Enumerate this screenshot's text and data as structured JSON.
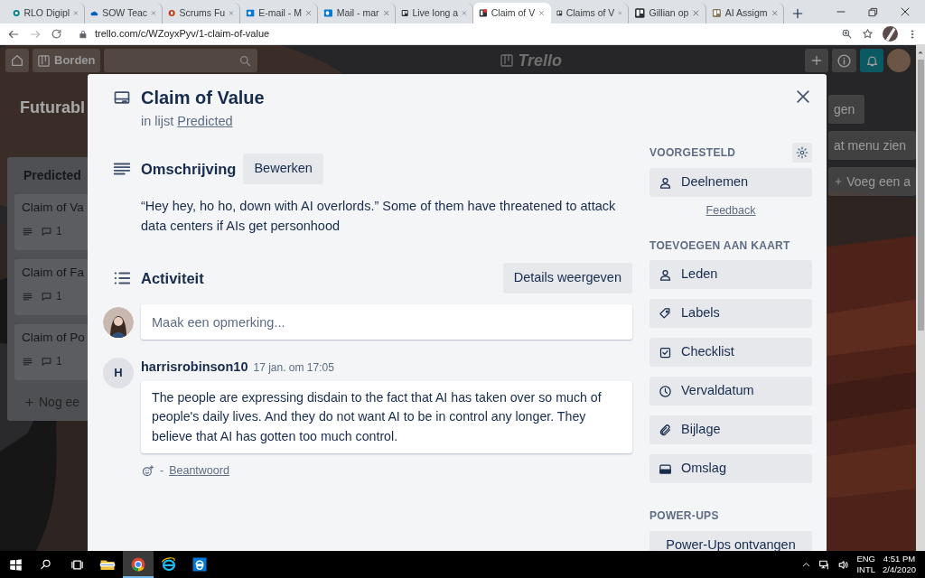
{
  "browser": {
    "tabs": [
      {
        "title": "RLO Digipl",
        "kind": "sharepoint",
        "selected": false
      },
      {
        "title": "SOW Teac",
        "kind": "onedrive",
        "selected": false
      },
      {
        "title": "Scrums Fu",
        "kind": "powerpoint",
        "selected": false
      },
      {
        "title": "E-mail - M",
        "kind": "outlook",
        "selected": false
      },
      {
        "title": "Mail - mar",
        "kind": "outlook",
        "selected": false
      },
      {
        "title": "Live long a",
        "kind": "trello",
        "selected": false
      },
      {
        "title": "Claim of V",
        "kind": "trello-alert",
        "selected": true
      },
      {
        "title": "Claims of V",
        "kind": "trello",
        "selected": false
      },
      {
        "title": "Gillian op",
        "kind": "trello",
        "selected": false
      },
      {
        "title": "AI Assigm",
        "kind": "trello-light",
        "selected": false
      }
    ],
    "url": "trello.com/c/WZoyxPyv/1-claim-of-value"
  },
  "board_header": {
    "boards_button": "Borden",
    "logo": "Trello"
  },
  "board": {
    "title": "Futurabl",
    "lists": [
      {
        "name": "Predicted",
        "cards": [
          {
            "title": "Claim of Va",
            "comments": "1"
          },
          {
            "title": "Claim of Fa",
            "comments": "1"
          },
          {
            "title": "Claim of Po",
            "comments": "1"
          }
        ],
        "add_card": "Nog ee"
      }
    ],
    "right_buttons": [
      "gen",
      "at menu zien"
    ],
    "add_list": "Voeg een a"
  },
  "card_detail": {
    "title": "Claim of Value",
    "list_prefix": "in lijst",
    "list_name": "Predicted",
    "description_heading": "Omschrijving",
    "edit_button": "Bewerken",
    "description": "“Hey hey, ho ho, down with AI overlords.” Some of them have threatened to attack data centers if AIs get personhood",
    "activity_heading": "Activiteit",
    "details_button": "Details weergeven",
    "comment_placeholder": "Maak een opmerking...",
    "comments": [
      {
        "avatar": "H",
        "author": "harrisrobinson10",
        "time": "17 jan. om 17:05",
        "text": "The people are expressing disdain to the fact that AI has taken over so much of people's daily lives. And they do not want AI to be in control any longer. They believe that AI has gotten too much control.",
        "separator": "-",
        "reply": "Beantwoord"
      }
    ]
  },
  "sidebar": {
    "suggested_heading": "VOORGESTELD",
    "join_button": "Deelnemen",
    "feedback": "Feedback",
    "add_heading": "TOEVOEGEN AAN KAART",
    "actions": [
      {
        "label": "Leden",
        "kind": "members"
      },
      {
        "label": "Labels",
        "kind": "labels"
      },
      {
        "label": "Checklist",
        "kind": "checklist"
      },
      {
        "label": "Vervaldatum",
        "kind": "due"
      },
      {
        "label": "Bijlage",
        "kind": "attachment"
      },
      {
        "label": "Omslag",
        "kind": "cover"
      }
    ],
    "powerups_heading": "POWER-UPS",
    "powerups_button": "Power-Ups ontvangen"
  },
  "taskbar": {
    "apps": [
      {
        "kind": "explorer",
        "selected": false
      },
      {
        "kind": "chrome",
        "selected": true
      },
      {
        "kind": "ie",
        "selected": false
      },
      {
        "kind": "edge",
        "selected": false
      }
    ],
    "language": "ENG",
    "layout": "INTL",
    "time": "4:51 PM",
    "date": "2/4/2020"
  }
}
